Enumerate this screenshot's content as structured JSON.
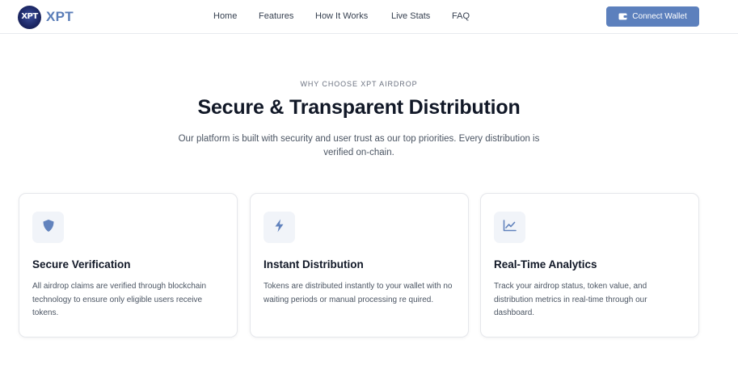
{
  "brand": {
    "logo_text": "XPT",
    "name": "XPT",
    "color": "#5a7db8"
  },
  "nav": {
    "items": [
      {
        "label": "Home"
      },
      {
        "label": "Features"
      },
      {
        "label": "How It Works"
      },
      {
        "label": "Live Stats"
      },
      {
        "label": "FAQ"
      }
    ],
    "connect_label": "Connect Wallet",
    "connect_icon": "wallet-icon",
    "accent": "#5c80bd"
  },
  "hero": {
    "eyebrow": "WHY CHOOSE XPT AIRDROP",
    "title": "Secure & Transparent Distribution",
    "subtitle": "Our platform is built with security and user trust as our top priorities. Every distribution is verified on-chain."
  },
  "features": [
    {
      "icon": "shield-icon",
      "title": "Secure Verification",
      "description": "All airdrop claims are verified through blockchain technology to ensure only eligible users receive tokens."
    },
    {
      "icon": "lightning-icon",
      "title": "Instant Distribution",
      "description": "Tokens are distributed instantly to your wallet with no waiting periods or manual processing re quired."
    },
    {
      "icon": "chart-line-icon",
      "title": "Real-Time Analytics",
      "description": "Track your airdrop status, token value, and distribution metrics in real-time through our dashboard."
    }
  ]
}
